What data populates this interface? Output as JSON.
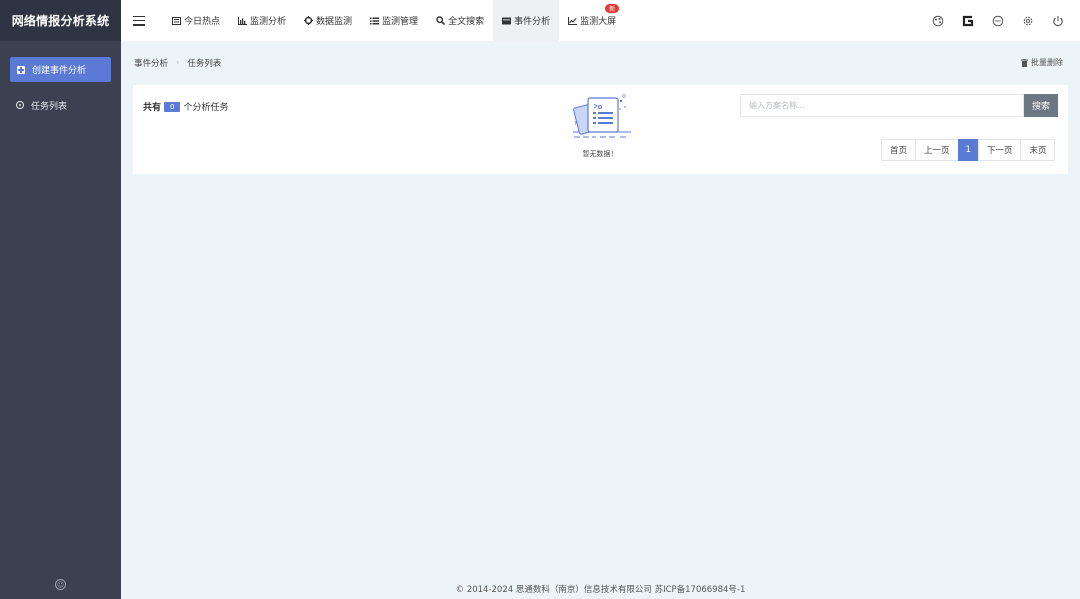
{
  "brand": {
    "title": "网络情报分析系统"
  },
  "sidebar": {
    "create_label": "创建事件分析",
    "items": [
      {
        "label": "任务列表"
      }
    ]
  },
  "nav": {
    "items": [
      {
        "label": "今日热点",
        "icon": "newspaper-icon"
      },
      {
        "label": "监测分析",
        "icon": "bar-chart-icon"
      },
      {
        "label": "数据监测",
        "icon": "crosshair-icon"
      },
      {
        "label": "监测管理",
        "icon": "list-icon"
      },
      {
        "label": "全文搜索",
        "icon": "search-icon"
      },
      {
        "label": "事件分析",
        "icon": "folder-icon",
        "active": true
      },
      {
        "label": "监测大屏",
        "icon": "line-chart-icon",
        "badge": "新"
      }
    ]
  },
  "breadcrumb": {
    "items": [
      "事件分析",
      "任务列表"
    ]
  },
  "toolbar": {
    "bulk_delete_label": "批量删除"
  },
  "summary": {
    "prefix": "共有",
    "count": "0",
    "suffix": "个分析任务"
  },
  "empty_state": {
    "text": "暂无数据！"
  },
  "search": {
    "placeholder": "输入方案名称...",
    "button_label": "搜索"
  },
  "pagination": {
    "first": "首页",
    "prev": "上一页",
    "current": "1",
    "next": "下一页",
    "last": "末页"
  },
  "footer": {
    "text": "© 2014-2024 思通数科（南京）信息技术有限公司 苏ICP备17066984号-1"
  },
  "colors": {
    "sidebar_bg": "#3b4150",
    "accent": "#5b7ad6",
    "content_bg": "#edf4f7"
  }
}
